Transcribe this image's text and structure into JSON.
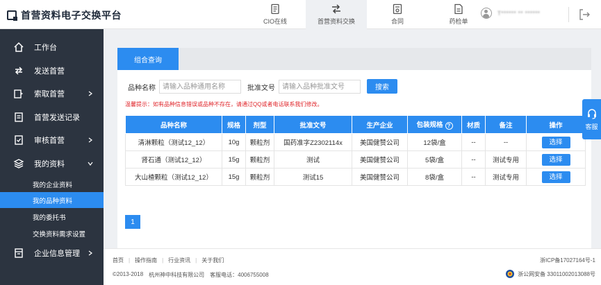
{
  "header": {
    "brand": "首营资料电子交换平台",
    "nav": [
      {
        "label": "CIO在线",
        "icon": "document-icon",
        "active": false
      },
      {
        "label": "首营资料交换",
        "icon": "exchange-icon",
        "active": true
      },
      {
        "label": "合同",
        "icon": "contract-icon",
        "active": false
      },
      {
        "label": "药检单",
        "icon": "report-icon",
        "active": false
      }
    ],
    "user_name": "T****** ** ******"
  },
  "sidebar": {
    "items": [
      {
        "label": "工作台",
        "icon": "home-icon"
      },
      {
        "label": "发送首营",
        "icon": "send-icon"
      },
      {
        "label": "索取首营",
        "icon": "request-icon"
      },
      {
        "label": "首营发送记录",
        "icon": "record-icon"
      },
      {
        "label": "审核首营",
        "icon": "review-icon"
      },
      {
        "label": "我的资料",
        "icon": "layers-icon"
      },
      {
        "label": "企业信息管理",
        "icon": "company-icon"
      }
    ],
    "sub_items": [
      {
        "label": "我的企业资料"
      },
      {
        "label": "我的品种资料",
        "active": true
      },
      {
        "label": "我的委托书"
      },
      {
        "label": "交换资料需求设置"
      }
    ]
  },
  "main": {
    "tab_label": "组合查询",
    "search": {
      "name_label": "品种名称",
      "name_placeholder": "请输入品种通用名称",
      "approval_label": "批准文号",
      "approval_placeholder": "请输入品种批准文号",
      "search_button": "搜索"
    },
    "tip": "温馨提示：如有品种信息错误或品种不存在，请通过QQ或者电话联系我们修改。",
    "table": {
      "headers": [
        "品种名称",
        "规格",
        "剂型",
        "批准文号",
        "生产企业",
        "包装规格",
        "材质",
        "备注",
        "操作"
      ],
      "rows": [
        {
          "name": "清淋颗粒（测试12_12）",
          "spec": "10g",
          "form": "颗粒剂",
          "approval": "国药准字Z2302114x",
          "maker": "美国健赞公司",
          "package": "12袋/盒",
          "material": "--",
          "note": "--",
          "action": "选择"
        },
        {
          "name": "肾石通（测试12_12）",
          "spec": "15g",
          "form": "颗粒剂",
          "approval": "测试",
          "maker": "美国健赞公司",
          "package": "5袋/盒",
          "material": "--",
          "note": "测试专用",
          "action": "选择"
        },
        {
          "name": "大山楂颗粒（测试12_12）",
          "spec": "15g",
          "form": "颗粒剂",
          "approval": "测试15",
          "maker": "美国健赞公司",
          "package": "8袋/盒",
          "material": "--",
          "note": "测试专用",
          "action": "选择"
        }
      ]
    },
    "pagination": {
      "current": "1"
    }
  },
  "float_service": {
    "label": "客服",
    "icon": "headset-icon"
  },
  "footer": {
    "links": [
      "首页",
      "操作指南",
      "行业资讯",
      "关于我们"
    ],
    "copyright": "©2013-2018",
    "company": "杭州神中科技有限公司",
    "hotline": "客服电话：4006755008",
    "icp": "浙ICP备17027164号-1",
    "police": "浙公网安备 33011002013088号"
  },
  "colors": {
    "accent": "#2c8cf0",
    "sidebar": "#2c3440",
    "warning": "#e0272c"
  }
}
